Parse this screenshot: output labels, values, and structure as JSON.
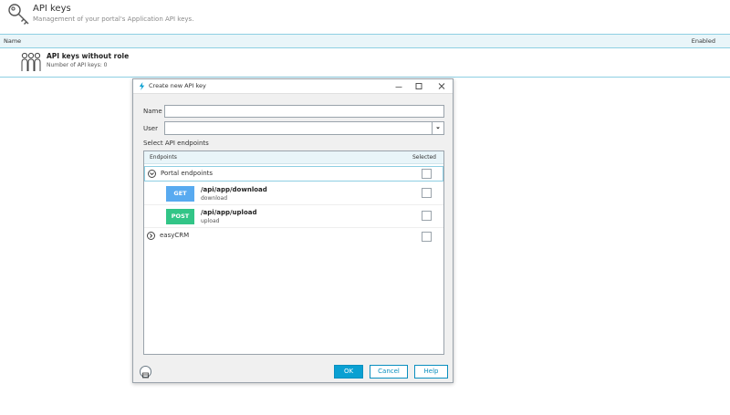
{
  "header": {
    "title": "API keys",
    "subtitle": "Management of your portal's Application API keys.",
    "icon": "key-icon"
  },
  "grid": {
    "col_name": "Name",
    "col_enabled": "Enabled",
    "row": {
      "title": "API keys without role",
      "subtitle": "Number of API keys: 0",
      "icon": "users-icon"
    }
  },
  "dialog": {
    "title": "Create new API key",
    "name_label": "Name",
    "name_value": "",
    "user_label": "User",
    "user_value": "",
    "section_label": "Select API endpoints",
    "col_endpoints": "Endpoints",
    "col_selected": "Selected",
    "groups": [
      {
        "label": "Portal endpoints",
        "expanded": true,
        "selected": false,
        "endpoints": [
          {
            "method": "GET",
            "path": "/api/app/download",
            "desc": "download",
            "selected": false
          },
          {
            "method": "POST",
            "path": "/api/app/upload",
            "desc": "upload",
            "selected": false
          }
        ]
      },
      {
        "label": "easyCRM",
        "expanded": false,
        "selected": false
      }
    ],
    "buttons": {
      "ok": "OK",
      "cancel": "Cancel",
      "help": "Help"
    },
    "colors": {
      "accent": "#0aa0d2",
      "get": "#58aaf0",
      "post": "#32c587",
      "header_bg": "#e9f5f9"
    }
  }
}
